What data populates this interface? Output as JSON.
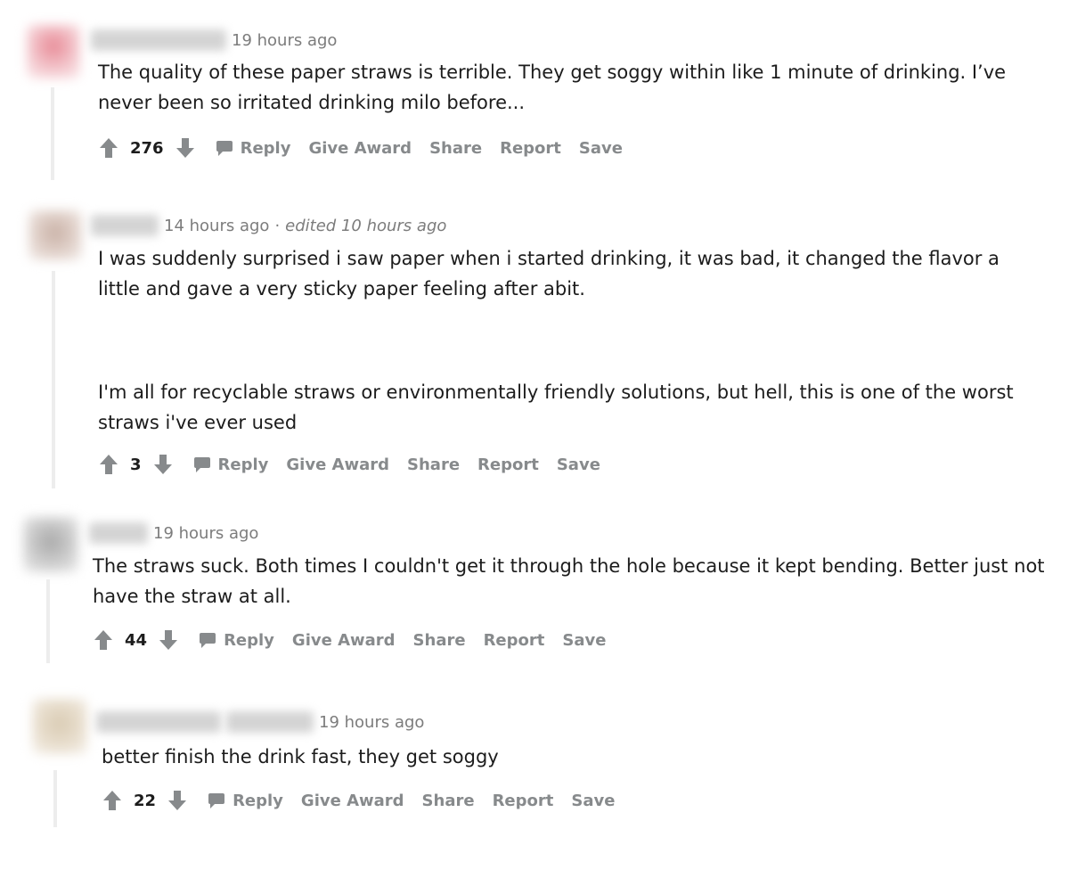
{
  "colors": {
    "muted_text": "#7c7c7c",
    "action_text": "#878a8c",
    "icon_gray": "#878a8c",
    "thread_line": "#ededed"
  },
  "icons": {
    "upvote": "arrow-up-icon",
    "downvote": "arrow-down-icon",
    "reply": "speech-bubble-icon"
  },
  "comments": [
    {
      "timestamp": "19 hours ago",
      "paragraphs": [
        "The quality of these paper straws is terrible. They get soggy within like 1 minute of drinking. I’ve never been so irritated drinking milo before..."
      ],
      "score": "276",
      "actions": {
        "reply": "Reply",
        "give_award": "Give Award",
        "share": "Share",
        "report": "Report",
        "save": "Save"
      }
    },
    {
      "timestamp": "14 hours ago",
      "separator": "·",
      "edited": "edited 10 hours ago",
      "paragraphs": [
        "I was suddenly surprised i saw paper when i started drinking, it was bad, it changed the flavor a little and gave a very sticky paper feeling after abit.",
        "I'm all for recyclable straws or environmentally friendly solutions, but hell, this is one of the worst straws i've ever used"
      ],
      "score": "3",
      "actions": {
        "reply": "Reply",
        "give_award": "Give Award",
        "share": "Share",
        "report": "Report",
        "save": "Save"
      }
    },
    {
      "timestamp": "19 hours ago",
      "paragraphs": [
        "The straws suck. Both times I couldn't get it through the hole because it kept bending. Better just not have the straw at all."
      ],
      "score": "44",
      "actions": {
        "reply": "Reply",
        "give_award": "Give Award",
        "share": "Share",
        "report": "Report",
        "save": "Save"
      }
    },
    {
      "timestamp": "19 hours ago",
      "paragraphs": [
        "better finish the drink fast, they get soggy"
      ],
      "score": "22",
      "actions": {
        "reply": "Reply",
        "give_award": "Give Award",
        "share": "Share",
        "report": "Report",
        "save": "Save"
      }
    }
  ]
}
